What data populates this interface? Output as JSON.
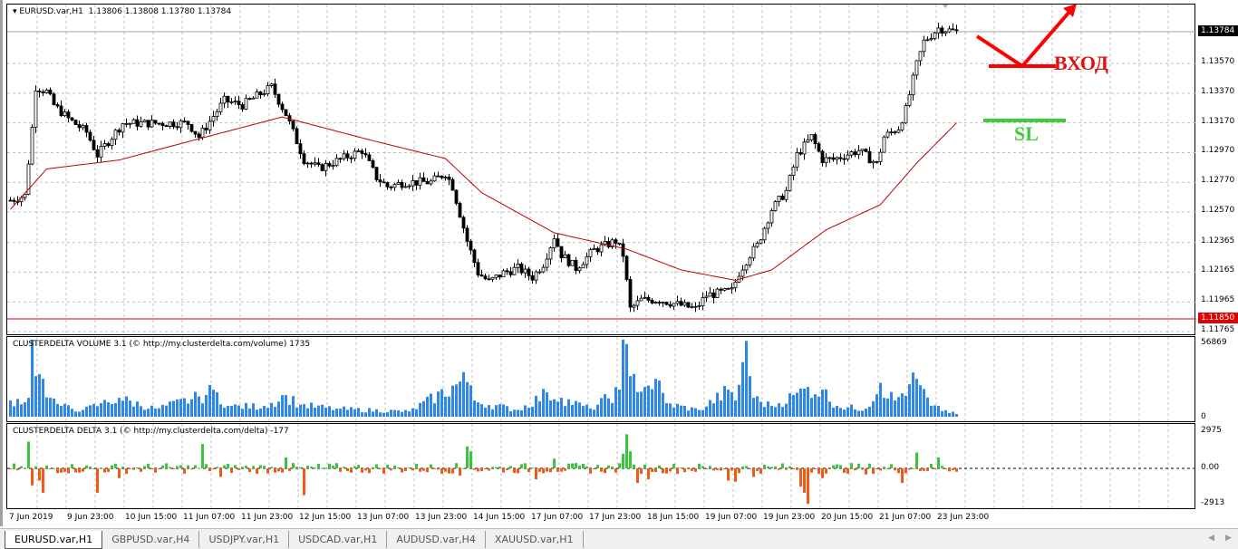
{
  "main": {
    "symbol": "EURUSD.var,H1",
    "ohlc": "1.13806 1.13808 1.13780 1.13784",
    "price_ticks": [
      "1.13570",
      "1.13370",
      "1.13170",
      "1.12970",
      "1.12770",
      "1.12570",
      "1.12365",
      "1.12165",
      "1.11965",
      "1.11765"
    ],
    "current_price": "1.13784",
    "level_price": "1.11850",
    "annotations": {
      "entry": "ВХОД",
      "stop": "SL"
    }
  },
  "volume": {
    "title": "CLUSTERDELTA VOLUME 3.1 (© http://my.clusterdelta.com/volume) 1735",
    "max_label": "56869",
    "min_label": "0"
  },
  "delta": {
    "title": "CLUSTERDELTA DELTA 3.1 (© http://my.clusterdelta.com/delta) -177",
    "max_label": "2975",
    "zero_label": "0.00",
    "min_label": "-2913"
  },
  "time_labels": [
    "7 Jun 2019",
    "9 Jun 23:00",
    "10 Jun 15:00",
    "11 Jun 07:00",
    "11 Jun 23:00",
    "12 Jun 15:00",
    "13 Jun 07:00",
    "13 Jun 23:00",
    "14 Jun 15:00",
    "17 Jun 07:00",
    "17 Jun 23:00",
    "18 Jun 15:00",
    "19 Jun 07:00",
    "19 Jun 23:00",
    "20 Jun 15:00",
    "21 Jun 07:00",
    "23 Jun 23:00"
  ],
  "tabs": [
    "EURUSD.var,H1",
    "GBPUSD.var,H4",
    "USDJPY.var,H1",
    "USDCAD.var,H1",
    "AUDUSD.var,H4",
    "XAUUSD.var,H1"
  ],
  "colors": {
    "ma": "#c00000",
    "level": "#e00000",
    "volume": "#2e86e8",
    "delta_pos": "#3cc43c",
    "delta_neg": "#f05a14",
    "entry": "#ff0000",
    "stop": "#3ccc3c"
  },
  "chart_data": {
    "type": "candlestick",
    "bars": 262,
    "price_range": [
      1.11765,
      1.13784
    ],
    "close_keypoints": [
      [
        0,
        1.12649
      ],
      [
        4,
        1.1268
      ],
      [
        6,
        1.13137
      ],
      [
        7,
        1.13412
      ],
      [
        10,
        1.13381
      ],
      [
        12,
        1.1329
      ],
      [
        16,
        1.13198
      ],
      [
        21,
        1.13107
      ],
      [
        24,
        1.12954
      ],
      [
        27,
        1.13046
      ],
      [
        31,
        1.13168
      ],
      [
        39,
        1.13168
      ],
      [
        49,
        1.13168
      ],
      [
        52,
        1.13076
      ],
      [
        59,
        1.1332
      ],
      [
        64,
        1.1329
      ],
      [
        72,
        1.13412
      ],
      [
        76,
        1.13229
      ],
      [
        81,
        1.12924
      ],
      [
        85,
        1.12863
      ],
      [
        91,
        1.12924
      ],
      [
        97,
        1.12985
      ],
      [
        101,
        1.12802
      ],
      [
        104,
        1.12741
      ],
      [
        109,
        1.12771
      ],
      [
        116,
        1.12771
      ],
      [
        120,
        1.12832
      ],
      [
        122,
        1.12741
      ],
      [
        126,
        1.12375
      ],
      [
        129,
        1.12161
      ],
      [
        132,
        1.121
      ],
      [
        136,
        1.12161
      ],
      [
        140,
        1.12192
      ],
      [
        144,
        1.12131
      ],
      [
        147,
        1.12222
      ],
      [
        150,
        1.12405
      ],
      [
        152,
        1.12283
      ],
      [
        156,
        1.12192
      ],
      [
        161,
        1.12314
      ],
      [
        167,
        1.12375
      ],
      [
        169,
        1.12283
      ],
      [
        171,
        1.11917
      ],
      [
        174,
        1.11978
      ],
      [
        179,
        1.11978
      ],
      [
        184,
        1.11948
      ],
      [
        189,
        1.11917
      ],
      [
        192,
        1.12009
      ],
      [
        199,
        1.12039
      ],
      [
        201,
        1.12161
      ],
      [
        204,
        1.12283
      ],
      [
        206,
        1.12344
      ],
      [
        210,
        1.12588
      ],
      [
        214,
        1.1271
      ],
      [
        217,
        1.12954
      ],
      [
        221,
        1.13076
      ],
      [
        224,
        1.12924
      ],
      [
        227,
        1.12924
      ],
      [
        234,
        1.12985
      ],
      [
        239,
        1.12893
      ],
      [
        241,
        1.13076
      ],
      [
        245,
        1.13137
      ],
      [
        247,
        1.13259
      ],
      [
        250,
        1.13564
      ],
      [
        252,
        1.13717
      ],
      [
        256,
        1.13808
      ],
      [
        261,
        1.13784
      ]
    ],
    "ma_keypoints": [
      [
        0,
        1.12588
      ],
      [
        10,
        1.1286
      ],
      [
        30,
        1.1292
      ],
      [
        50,
        1.1305
      ],
      [
        75,
        1.1321
      ],
      [
        100,
        1.1305
      ],
      [
        120,
        1.1293
      ],
      [
        130,
        1.127
      ],
      [
        150,
        1.1243
      ],
      [
        170,
        1.1232
      ],
      [
        185,
        1.1218
      ],
      [
        200,
        1.1211
      ],
      [
        210,
        1.1218
      ],
      [
        225,
        1.1245
      ],
      [
        240,
        1.1262
      ],
      [
        250,
        1.129
      ],
      [
        261,
        1.1317
      ]
    ],
    "level": 1.1185,
    "volume_keypoints": [
      [
        0,
        12000
      ],
      [
        5,
        14000
      ],
      [
        6,
        56869
      ],
      [
        7,
        30000
      ],
      [
        9,
        28000
      ],
      [
        11,
        14000
      ],
      [
        14,
        8000
      ],
      [
        20,
        5000
      ],
      [
        25,
        10000
      ],
      [
        30,
        14000
      ],
      [
        40,
        6000
      ],
      [
        52,
        15000
      ],
      [
        56,
        20000
      ],
      [
        60,
        8000
      ],
      [
        70,
        8000
      ],
      [
        76,
        16000
      ],
      [
        80,
        9000
      ],
      [
        90,
        6000
      ],
      [
        110,
        4000
      ],
      [
        124,
        26000
      ],
      [
        125,
        33000
      ],
      [
        128,
        12000
      ],
      [
        140,
        5000
      ],
      [
        148,
        18000
      ],
      [
        152,
        14000
      ],
      [
        160,
        6000
      ],
      [
        168,
        20000
      ],
      [
        169,
        56869
      ],
      [
        171,
        30000
      ],
      [
        175,
        22000
      ],
      [
        178,
        28000
      ],
      [
        181,
        10000
      ],
      [
        190,
        5000
      ],
      [
        198,
        20000
      ],
      [
        200,
        12000
      ],
      [
        203,
        56000
      ],
      [
        205,
        14000
      ],
      [
        210,
        8000
      ],
      [
        216,
        16000
      ],
      [
        220,
        22000
      ],
      [
        224,
        20000
      ],
      [
        228,
        8000
      ],
      [
        236,
        6000
      ],
      [
        240,
        25000
      ],
      [
        244,
        12000
      ],
      [
        248,
        24000
      ],
      [
        250,
        28000
      ],
      [
        254,
        8000
      ],
      [
        261,
        2000
      ]
    ],
    "delta_spikes": [
      [
        5,
        2200
      ],
      [
        6,
        -1400
      ],
      [
        8,
        -1000
      ],
      [
        9,
        -2000
      ],
      [
        24,
        -2000
      ],
      [
        30,
        -800
      ],
      [
        53,
        2000
      ],
      [
        58,
        -700
      ],
      [
        81,
        -2200
      ],
      [
        76,
        900
      ],
      [
        126,
        1800
      ],
      [
        127,
        1400
      ],
      [
        124,
        -600
      ],
      [
        145,
        -900
      ],
      [
        150,
        800
      ],
      [
        169,
        1200
      ],
      [
        170,
        2800
      ],
      [
        171,
        1400
      ],
      [
        173,
        -1200
      ],
      [
        176,
        -900
      ],
      [
        198,
        -1000
      ],
      [
        200,
        -1100
      ],
      [
        205,
        -700
      ],
      [
        218,
        -1500
      ],
      [
        219,
        -2000
      ],
      [
        220,
        -2913
      ],
      [
        224,
        -800
      ],
      [
        246,
        -1200
      ],
      [
        250,
        1300
      ],
      [
        256,
        900
      ],
      [
        236,
        -500
      ]
    ]
  }
}
